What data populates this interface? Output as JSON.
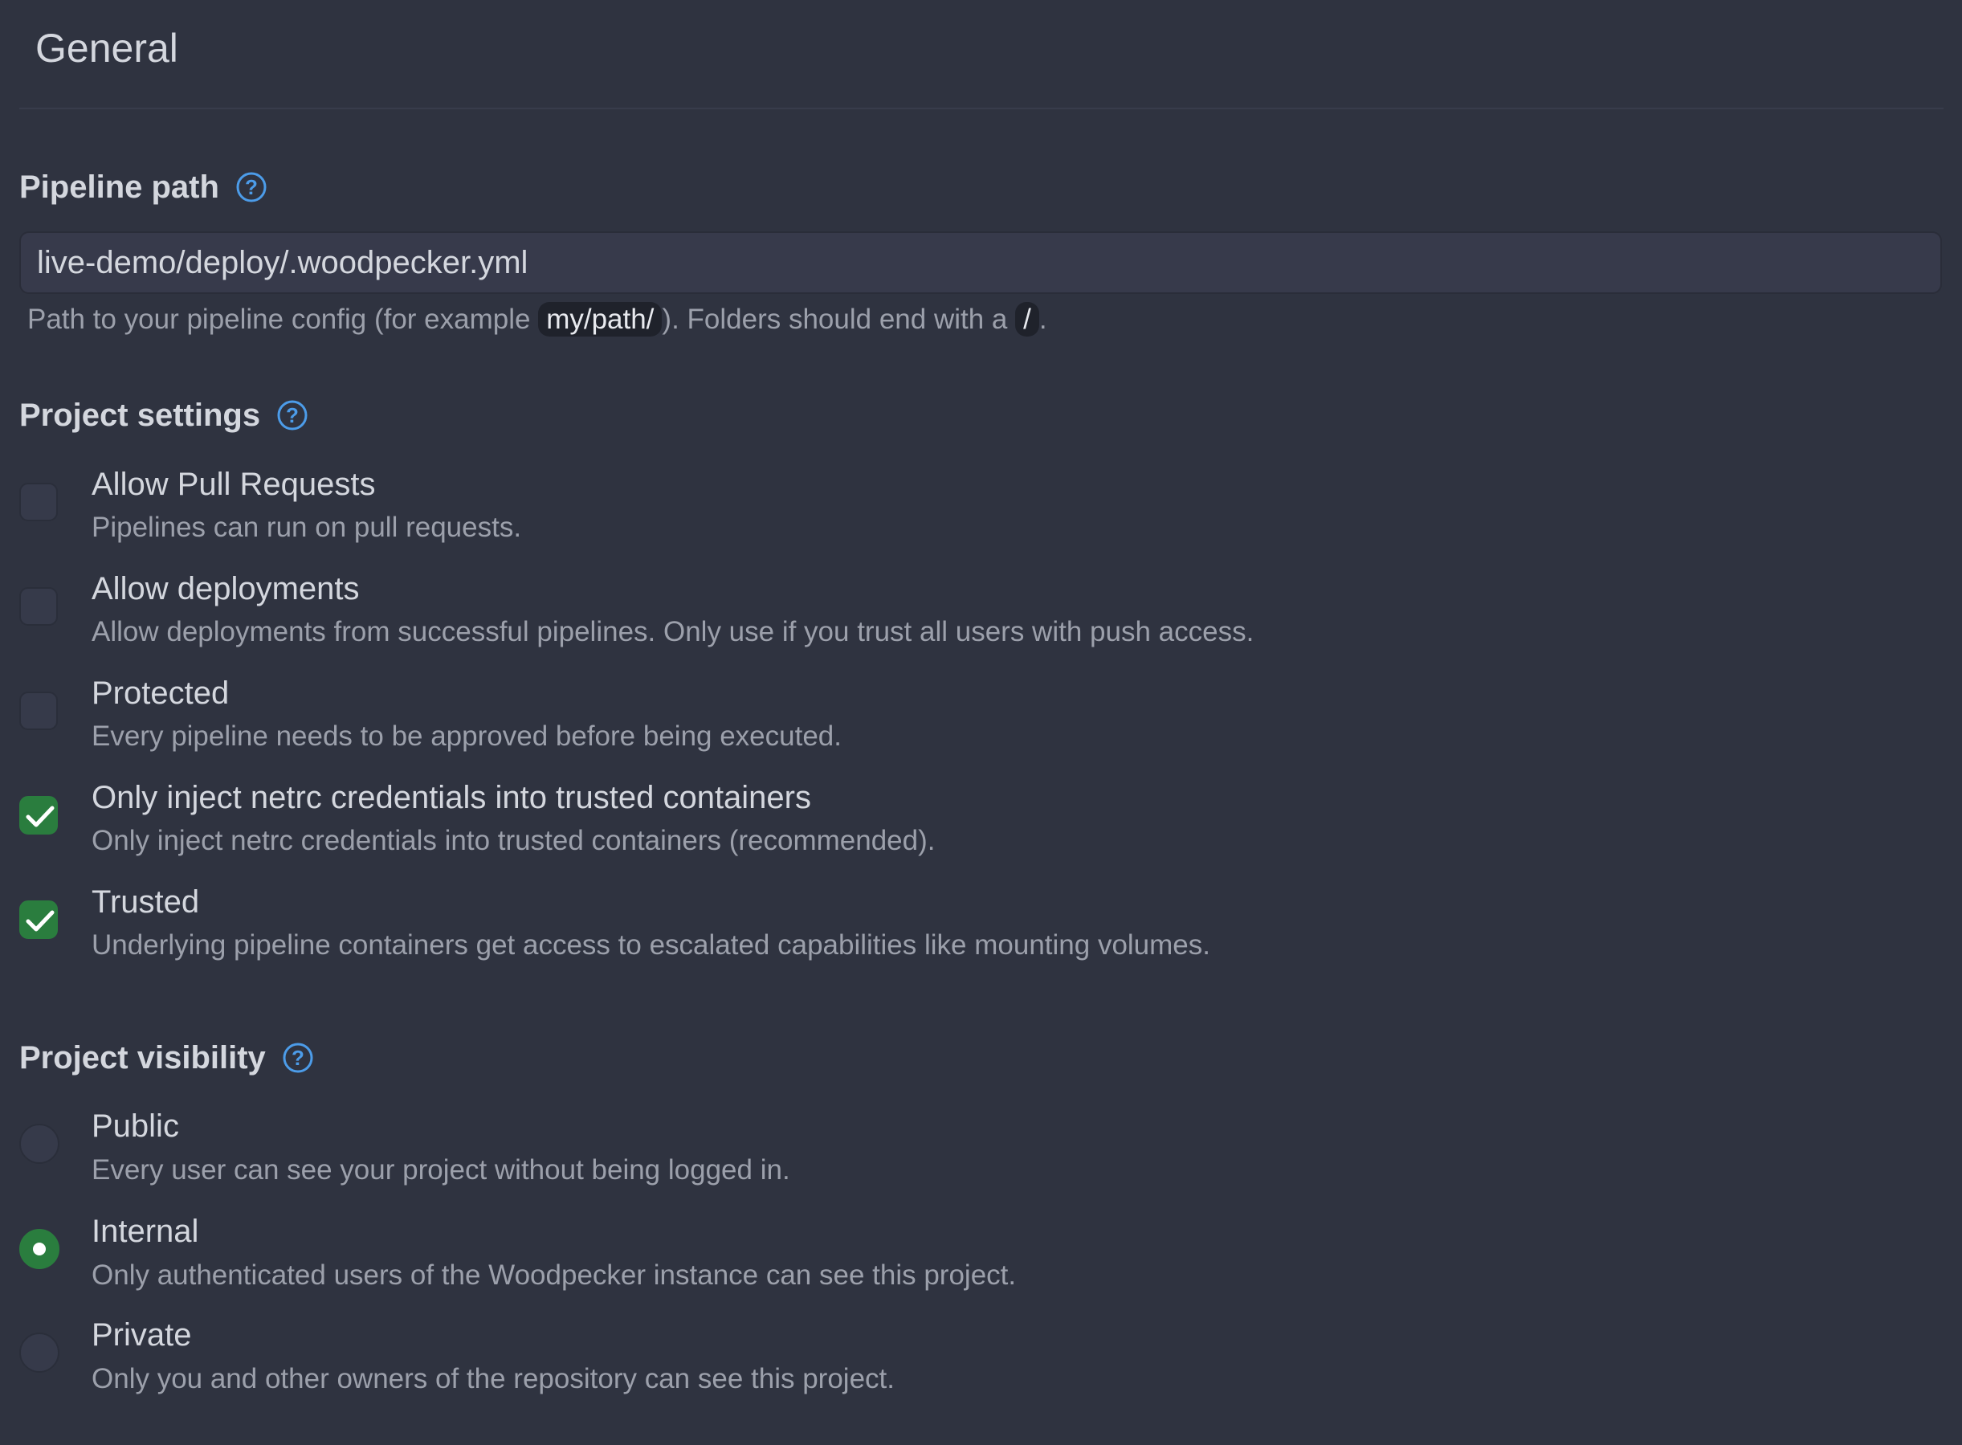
{
  "page": {
    "title": "General"
  },
  "pipeline_path": {
    "heading": "Pipeline path",
    "value": "live-demo/deploy/.woodpecker.yml",
    "hint_prefix": "Path to your pipeline config (for example ",
    "hint_code_example": "my/path/",
    "hint_middle": "). Folders should end with a ",
    "hint_code_slash": "/",
    "hint_suffix": "."
  },
  "project_settings": {
    "heading": "Project settings",
    "options": [
      {
        "title": "Allow Pull Requests",
        "description": "Pipelines can run on pull requests.",
        "checked": false
      },
      {
        "title": "Allow deployments",
        "description": "Allow deployments from successful pipelines. Only use if you trust all users with push access.",
        "checked": false
      },
      {
        "title": "Protected",
        "description": "Every pipeline needs to be approved before being executed.",
        "checked": false
      },
      {
        "title": "Only inject netrc credentials into trusted containers",
        "description": "Only inject netrc credentials into trusted containers (recommended).",
        "checked": true
      },
      {
        "title": "Trusted",
        "description": "Underlying pipeline containers get access to escalated capabilities like mounting volumes.",
        "checked": true
      }
    ]
  },
  "project_visibility": {
    "heading": "Project visibility",
    "selected": "Internal",
    "options": [
      {
        "title": "Public",
        "description": "Every user can see your project without being logged in.",
        "selected": false
      },
      {
        "title": "Internal",
        "description": "Only authenticated users of the Woodpecker instance can see this project.",
        "selected": true
      },
      {
        "title": "Private",
        "description": "Only you and other owners of the repository can see this project.",
        "selected": false
      }
    ]
  },
  "icons": {
    "help": "help-circle-icon",
    "check": "checkmark-icon"
  },
  "colors": {
    "background": "#2f3340",
    "accent_green": "#2a7d3e",
    "help_blue": "#4c9ce9",
    "text_primary": "#d4d7de",
    "text_secondary": "#9ca0ab"
  }
}
